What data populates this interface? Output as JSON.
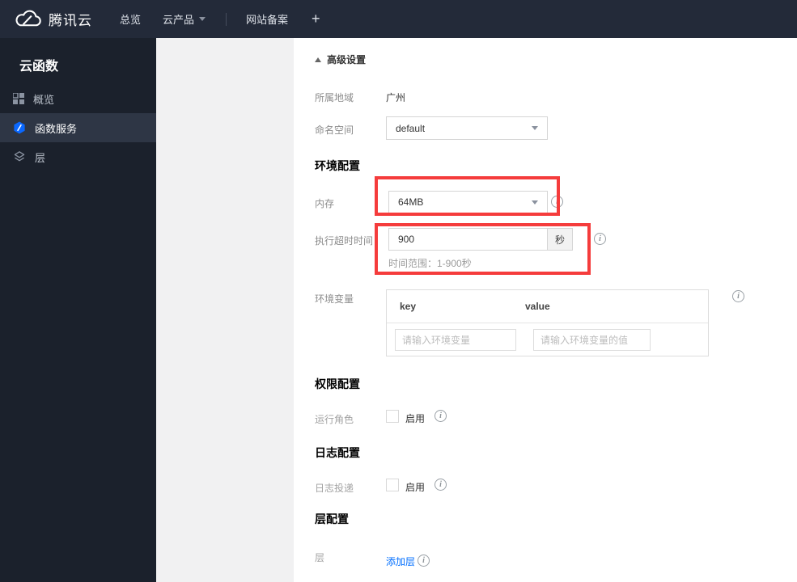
{
  "topnav": {
    "brand": "腾讯云",
    "items": [
      {
        "label": "总览"
      },
      {
        "label": "云产品"
      },
      {
        "label": "网站备案"
      },
      {
        "label": "+"
      }
    ]
  },
  "sidebar": {
    "title": "云函数",
    "items": [
      {
        "label": "概览",
        "icon": "grid-icon",
        "active": false
      },
      {
        "label": "函数服务",
        "icon": "scf-hexagon-icon",
        "active": true
      },
      {
        "label": "层",
        "icon": "layers-icon",
        "active": false
      }
    ]
  },
  "main": {
    "advanced_toggle_label": "高级设置",
    "region_label": "所属地域",
    "region_value": "广州",
    "namespace_label": "命名空间",
    "namespace_value": "default",
    "env_section_title": "环境配置",
    "memory_label": "内存",
    "memory_value": "64MB",
    "timeout_label": "执行超时时间",
    "timeout_value": "900",
    "timeout_unit": "秒",
    "timeout_hint": "时间范围：1-900秒",
    "envvars_label": "环境变量",
    "envvars_key_header": "key",
    "envvars_value_header": "value",
    "envvars_key_placeholder": "请输入环境变量",
    "envvars_value_placeholder": "请输入环境变量的值",
    "perm_section_title": "权限配置",
    "role_label": "运行角色",
    "role_enable_label": "启用",
    "log_section_title": "日志配置",
    "log_delivery_label": "日志投递",
    "log_enable_label": "启用",
    "layer_section_title": "层配置",
    "layer_label": "层",
    "add_layer_label": "添加层"
  },
  "colors": {
    "accent_blue": "#006eff",
    "highlight_red": "#f53c3c",
    "topbar_bg": "#232a39",
    "sidebar_bg": "#1b212c",
    "sidebar_active_bg": "#2e3645",
    "scf_icon_blue": "#0a68ff"
  }
}
